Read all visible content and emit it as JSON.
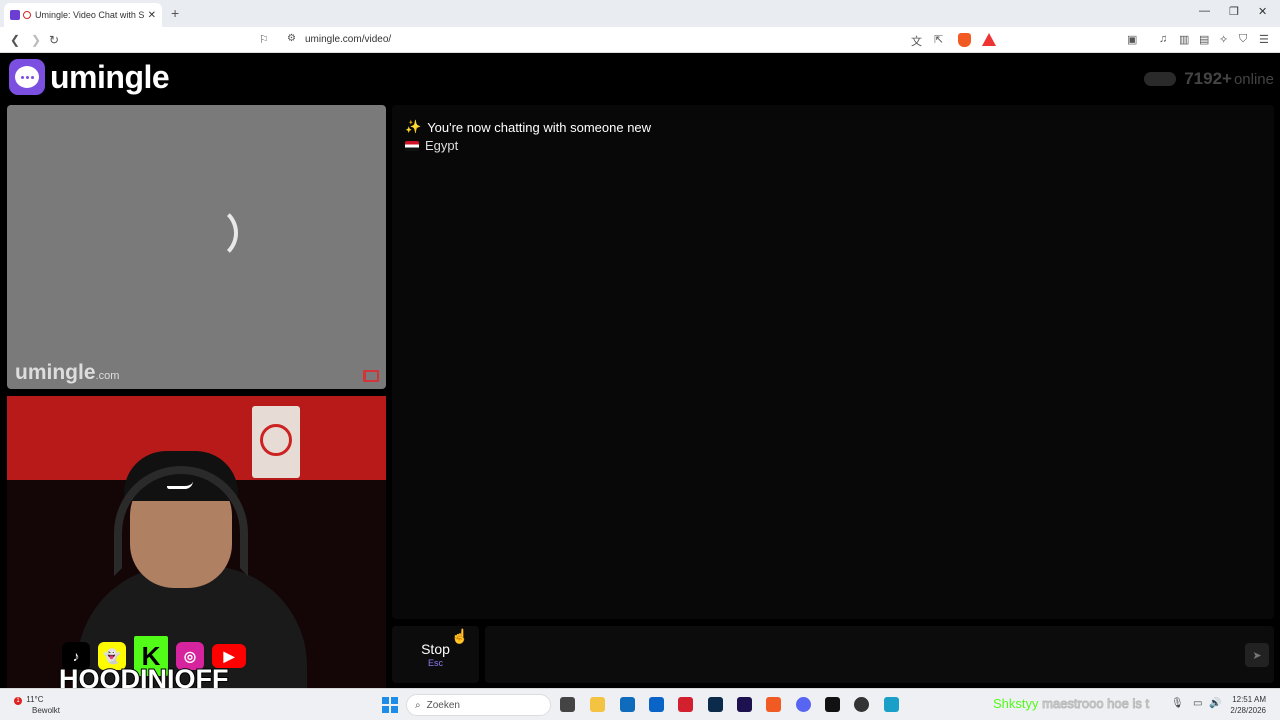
{
  "browser": {
    "tab_title": "Umingle: Video Chat with Str",
    "tab_close": "✕",
    "new_tab": "+",
    "url": "umingle.com/video/",
    "win_minimize": "—",
    "win_maximize": "❐",
    "win_close": "✕"
  },
  "header": {
    "logo_text": "umingle",
    "online_count": "7192+",
    "online_label": "online"
  },
  "stranger_video": {
    "watermark": "umingle",
    "watermark_suffix": ".com"
  },
  "self_video": {
    "streamer_name": "HOODINIOFF",
    "socials": [
      "tiktok-icon",
      "snapchat-icon",
      "kick-icon",
      "instagram-icon",
      "youtube-icon"
    ]
  },
  "chat": {
    "status_message": "You're now chatting with someone new",
    "country": "Egypt"
  },
  "controls": {
    "stop_label": "Stop",
    "stop_key": "Esc",
    "message_placeholder": ""
  },
  "taskbar": {
    "weather_temp": "11°C",
    "weather_desc": "Bewolkt",
    "weather_badge": "1",
    "search_placeholder": "Zoeken",
    "tray_text_1": "Shkstyy",
    "tray_text_2": "maestrooo hoe is t",
    "time": "12:51 AM",
    "date": "2/28/2026"
  },
  "colors": {
    "accent": "#7b4fe0",
    "stop_key_color": "#8e7cf4",
    "report_flag": "#d3343a"
  }
}
